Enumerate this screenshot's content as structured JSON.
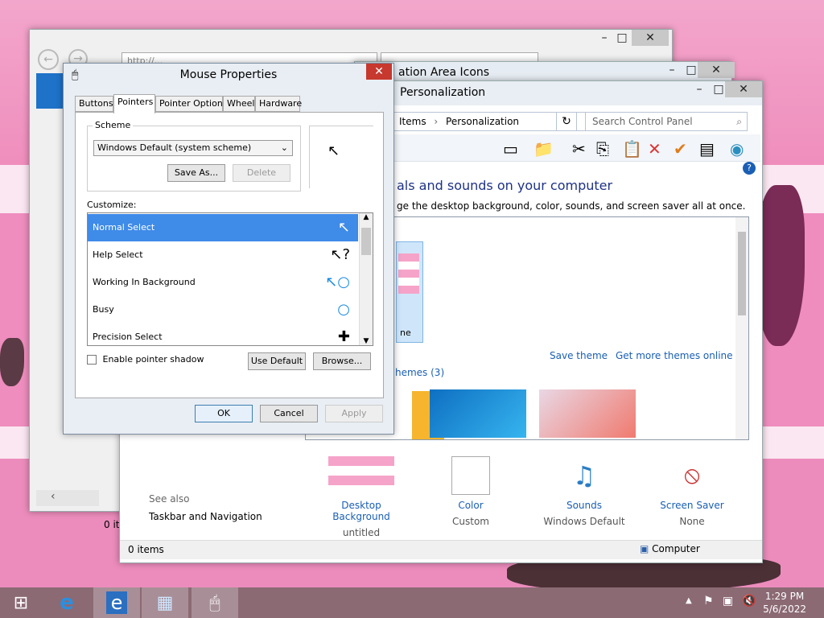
{
  "browser": {
    "address_text": "http://...",
    "tab_title": "...",
    "status_text": "0 it"
  },
  "notification_window": {
    "title": "ation Area Icons"
  },
  "personalization": {
    "title": "Personalization",
    "breadcrumb": [
      "Items",
      "Personalization"
    ],
    "search_placeholder": "Search Control Panel",
    "heading": "als and sounds on your computer",
    "subheading": "ge the desktop background, color, sounds, and screen saver all at once.",
    "theme_partial_label": "ne",
    "save_theme": "Save theme",
    "get_more_themes": "Get more themes online",
    "installed_themes_label": "hemes (3)",
    "see_also": "See also",
    "taskbar_navigation": "Taskbar and Navigation",
    "status_items": "0 items",
    "status_computer": "Computer",
    "bottom": [
      {
        "label": "Desktop Background",
        "value": "untitled",
        "icon": "desktop-background-thumb"
      },
      {
        "label": "Color",
        "value": "Custom",
        "icon": "color-swatch"
      },
      {
        "label": "Sounds",
        "value": "Windows Default",
        "icon": "sounds-icon"
      },
      {
        "label": "Screen Saver",
        "value": "None",
        "icon": "screen-saver-icon"
      }
    ]
  },
  "mouse_dialog": {
    "title": "Mouse Properties",
    "tabs": [
      "Buttons",
      "Pointers",
      "Pointer Options",
      "Wheel",
      "Hardware"
    ],
    "active_tab": "Pointers",
    "scheme_label": "Scheme",
    "scheme_value": "Windows Default (system scheme)",
    "save_as": "Save As...",
    "delete": "Delete",
    "customize_label": "Customize:",
    "pointer_list": [
      {
        "name": "Normal Select",
        "icon": "arrow-cursor-icon",
        "glyph": "↖"
      },
      {
        "name": "Help Select",
        "icon": "help-cursor-icon",
        "glyph": "↖?"
      },
      {
        "name": "Working In Background",
        "icon": "working-cursor-icon",
        "glyph": "↖○"
      },
      {
        "name": "Busy",
        "icon": "busy-cursor-icon",
        "glyph": "○"
      },
      {
        "name": "Precision Select",
        "icon": "crosshair-cursor-icon",
        "glyph": "✚"
      }
    ],
    "selected_pointer": "Normal Select",
    "enable_shadow": "Enable pointer shadow",
    "use_default": "Use Default",
    "browse": "Browse...",
    "ok": "OK",
    "cancel": "Cancel",
    "apply": "Apply"
  },
  "taskbar": {
    "time": "1:29 PM",
    "date": "5/6/2022"
  },
  "colors": {
    "accent_blue": "#3f8be8",
    "link_blue": "#1a5fb4",
    "close_red": "#c7382e",
    "desktop_pink": "#ee8dbe"
  }
}
